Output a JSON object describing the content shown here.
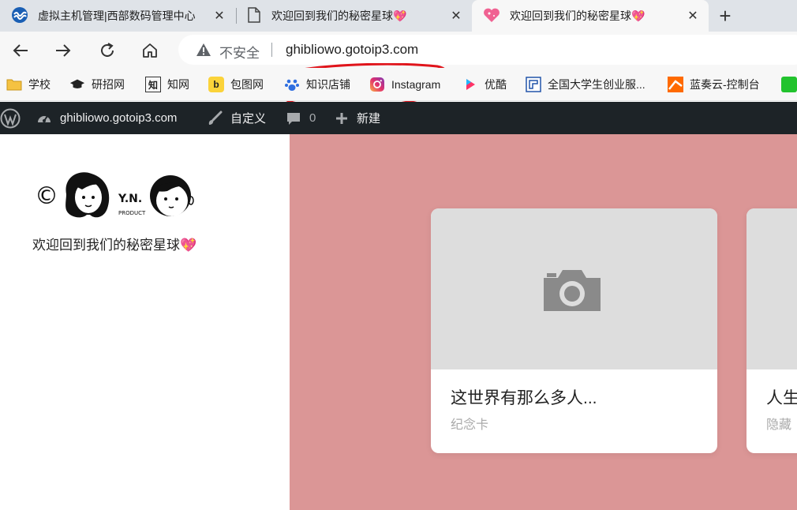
{
  "browser": {
    "tabs": [
      {
        "title": "虚拟主机管理|西部数码管理中心",
        "icon": "west-digital-icon"
      },
      {
        "title": "欢迎回到我们的秘密星球💖",
        "icon": "page-icon"
      },
      {
        "title": "欢迎回到我们的秘密星球💖",
        "icon": "heart-icon",
        "active": true
      }
    ],
    "close_glyph": "✕",
    "new_tab_glyph": "+",
    "address": {
      "security_label": "不安全",
      "url": "ghibliowo.gotoip3.com"
    },
    "bookmarks": [
      {
        "label": "学校",
        "icon": "folder-icon"
      },
      {
        "label": "研招网",
        "icon": "graduation-cap-icon"
      },
      {
        "label": "知网",
        "icon": "cnki-icon",
        "glyph": "知"
      },
      {
        "label": "包图网",
        "icon": "baotu-icon",
        "glyph": "b"
      },
      {
        "label": "知识店铺",
        "icon": "baidu-paw-icon"
      },
      {
        "label": "Instagram",
        "icon": "instagram-icon"
      },
      {
        "label": "优酷",
        "icon": "youku-icon"
      },
      {
        "label": "全国大学生创业服...",
        "icon": "startup-service-icon"
      },
      {
        "label": "蓝奏云-控制台",
        "icon": "lanzou-icon"
      }
    ]
  },
  "wp_admin_bar": {
    "site_name": "ghibliowo.gotoip3.com",
    "customize": "自定义",
    "comments_count": "0",
    "new": "新建"
  },
  "site": {
    "logo_text": "©",
    "logo_tag": "Y.N.",
    "logo_product": "PRODUCT",
    "tagline": "欢迎回到我们的秘密星球💖"
  },
  "cards": [
    {
      "title": "这世界有那么多人...",
      "category": "纪念卡"
    },
    {
      "title": "人生",
      "category": "隐藏"
    }
  ],
  "colors": {
    "tabstrip": "#dfe3e8",
    "toolbar": "#f7f7f7",
    "wp_bar": "#1d2327",
    "content_bg": "#db9696",
    "placeholder": "#dddddd",
    "scribble": "#e0141b"
  }
}
